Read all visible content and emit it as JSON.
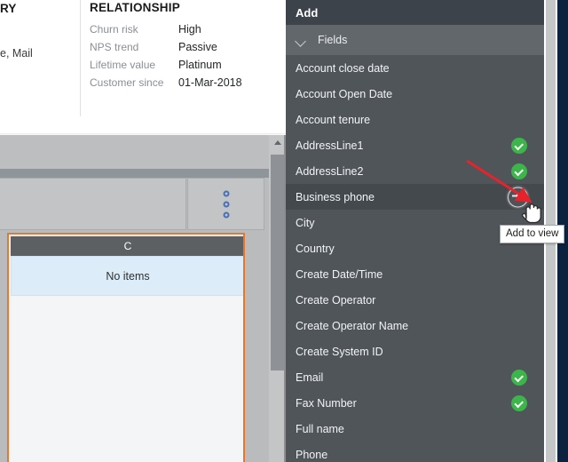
{
  "summary_card": {
    "left_title": "RY",
    "left_subtext": "e, Mail",
    "relationship": {
      "title": "RELATIONSHIP",
      "rows": [
        {
          "label": "Churn risk",
          "value": "High"
        },
        {
          "label": "NPS trend",
          "value": "Passive"
        },
        {
          "label": "Lifetime value",
          "value": "Platinum"
        },
        {
          "label": "Customer since",
          "value": "01-Mar-2018"
        }
      ]
    }
  },
  "workspace": {
    "kebab_menu": "⋮",
    "grid": {
      "column_header": "C",
      "empty_message": "No items"
    },
    "scrollbar": {
      "up_arrow": "scroll-up-arrow"
    },
    "accent_color": "#e8762c"
  },
  "add_panel": {
    "header_title": "Add",
    "section": {
      "label": "Fields",
      "expanded": true,
      "chevron": "chevron-down-icon"
    },
    "fields": [
      {
        "label": "Account close date",
        "state": "none"
      },
      {
        "label": "Account Open Date",
        "state": "none"
      },
      {
        "label": "Account tenure",
        "state": "none"
      },
      {
        "label": "AddressLine1",
        "state": "added"
      },
      {
        "label": "AddressLine2",
        "state": "added"
      },
      {
        "label": "Business phone",
        "state": "add",
        "selected": true
      },
      {
        "label": "City",
        "state": "none"
      },
      {
        "label": "Country",
        "state": "none"
      },
      {
        "label": "Create Date/Time",
        "state": "none"
      },
      {
        "label": "Create Operator",
        "state": "none"
      },
      {
        "label": "Create Operator Name",
        "state": "none"
      },
      {
        "label": "Create System ID",
        "state": "none"
      },
      {
        "label": "Email",
        "state": "added"
      },
      {
        "label": "Fax Number",
        "state": "added"
      },
      {
        "label": "Full name",
        "state": "none"
      },
      {
        "label": "Phone",
        "state": "none"
      }
    ],
    "added_color": "#3cb54a",
    "panel_color": "#50555a"
  },
  "overlay": {
    "tooltip_text": "Add to view",
    "arrow_color": "#e8222a",
    "cursor": "pointer-hand-cursor"
  }
}
